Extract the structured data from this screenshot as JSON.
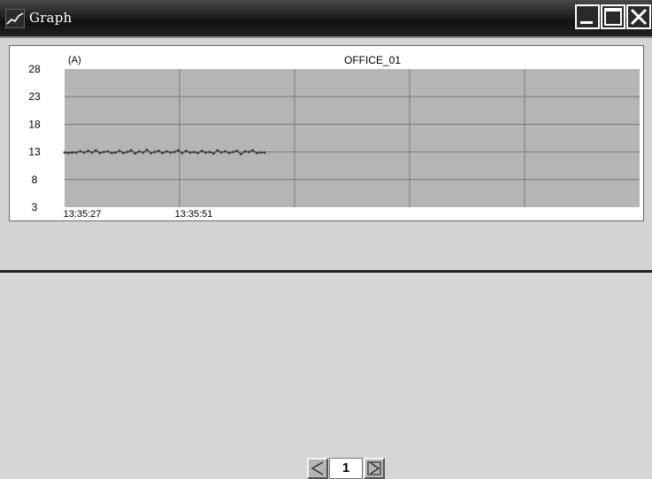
{
  "window": {
    "title": "Graph",
    "app_icon": "graph-line-icon"
  },
  "controls": {
    "minimize": "minimize-icon",
    "maximize": "maximize-icon",
    "close": "close-icon"
  },
  "chart_data": {
    "type": "line",
    "title": "OFFICE_01",
    "unit_label": "(A)",
    "y_ticks": [
      28,
      23,
      18,
      13,
      8,
      3
    ],
    "ylim": [
      3,
      28
    ],
    "x_tick_labels": [
      "13:35:27",
      "13:35:51"
    ],
    "grid": true,
    "plot_background": "#b5b5b5",
    "grid_color": "#7a7a7a",
    "series": [
      {
        "color": "#3a3a3a",
        "values": [
          12.9,
          12.8,
          12.9,
          12.9,
          13.1,
          12.9,
          13.2,
          12.9,
          13.3,
          12.8,
          13.0,
          13.1,
          12.8,
          12.9,
          13.2,
          12.8,
          13.0,
          13.3,
          12.7,
          13.1,
          12.9,
          13.4,
          12.8,
          13.0,
          13.2,
          12.8,
          13.1,
          12.9,
          13.0,
          13.3,
          12.8,
          13.2,
          12.9,
          13.0,
          12.8,
          13.2,
          12.9,
          13.0,
          12.7,
          13.3,
          12.9,
          13.1,
          12.8,
          13.0,
          13.2,
          12.6,
          13.1,
          13.0,
          13.3,
          12.8,
          12.9,
          12.9
        ]
      }
    ]
  },
  "pager": {
    "prev_icon": "prev-page-icon",
    "next_icon": "next-page-icon",
    "page": "1"
  }
}
